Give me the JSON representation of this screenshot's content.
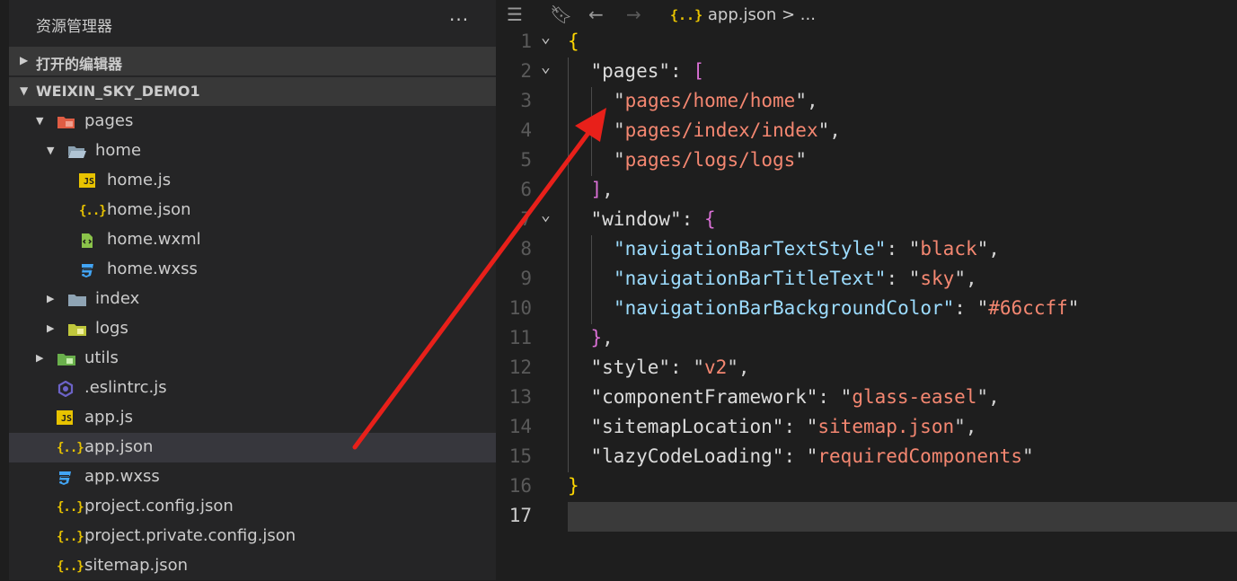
{
  "sidebar": {
    "title": "资源管理器",
    "more": "···",
    "open_editors": "打开的编辑器",
    "project": "WEIXIN_SKY_DEMO1",
    "tree": [
      {
        "name": "pages",
        "indent": 1,
        "twisty": "down",
        "icon": "folder-pages"
      },
      {
        "name": "home",
        "indent": 2,
        "twisty": "down",
        "icon": "folder-open"
      },
      {
        "name": "home.js",
        "indent": 3,
        "icon": "js"
      },
      {
        "name": "home.json",
        "indent": 3,
        "icon": "json"
      },
      {
        "name": "home.wxml",
        "indent": 3,
        "icon": "wxml"
      },
      {
        "name": "home.wxss",
        "indent": 3,
        "icon": "wxss"
      },
      {
        "name": "index",
        "indent": 2,
        "twisty": "right",
        "icon": "folder"
      },
      {
        "name": "logs",
        "indent": 2,
        "twisty": "right",
        "icon": "folder-logs"
      },
      {
        "name": "utils",
        "indent": 1,
        "twisty": "right",
        "icon": "folder-utils"
      },
      {
        "name": ".eslintrc.js",
        "indent": 1,
        "icon": "eslint"
      },
      {
        "name": "app.js",
        "indent": 1,
        "icon": "js"
      },
      {
        "name": "app.json",
        "indent": 1,
        "icon": "json",
        "selected": true
      },
      {
        "name": "app.wxss",
        "indent": 1,
        "icon": "wxss"
      },
      {
        "name": "project.config.json",
        "indent": 1,
        "icon": "json"
      },
      {
        "name": "project.private.config.json",
        "indent": 1,
        "icon": "json"
      },
      {
        "name": "sitemap.json",
        "indent": 1,
        "icon": "json"
      }
    ]
  },
  "editor": {
    "breadcrumb_icon": "{..}",
    "breadcrumb_file": "app.json",
    "breadcrumb_more": "> ...",
    "current_line": 17,
    "lines": [
      {
        "n": "1",
        "fold": true,
        "indent": 0,
        "tokens": [
          [
            "{",
            "brace"
          ]
        ]
      },
      {
        "n": "2",
        "fold": true,
        "indent": 1,
        "tokens": [
          [
            "\"pages\"",
            "key2"
          ],
          [
            ": ",
            "punc"
          ],
          [
            "[",
            "bracket"
          ]
        ]
      },
      {
        "n": "3",
        "indent": 2,
        "tokens": [
          [
            "\"",
            "punc"
          ],
          [
            "pages/home/home",
            "strr"
          ],
          [
            "\"",
            "punc"
          ],
          [
            ",",
            "punc"
          ]
        ]
      },
      {
        "n": "4",
        "indent": 2,
        "tokens": [
          [
            "\"",
            "punc"
          ],
          [
            "pages/index/index",
            "strr"
          ],
          [
            "\"",
            "punc"
          ],
          [
            ",",
            "punc"
          ]
        ]
      },
      {
        "n": "5",
        "indent": 2,
        "tokens": [
          [
            "\"",
            "punc"
          ],
          [
            "pages/logs/logs",
            "strr"
          ],
          [
            "\"",
            "punc"
          ]
        ]
      },
      {
        "n": "6",
        "indent": 1,
        "tokens": [
          [
            "]",
            "bracket"
          ],
          [
            ",",
            "punc"
          ]
        ]
      },
      {
        "n": "7",
        "fold": true,
        "indent": 1,
        "tokens": [
          [
            "\"window\"",
            "key2"
          ],
          [
            ": ",
            "punc"
          ],
          [
            "{",
            "bracket"
          ]
        ]
      },
      {
        "n": "8",
        "indent": 2,
        "tokens": [
          [
            "\"navigationBarTextStyle\"",
            "key"
          ],
          [
            ": ",
            "punc"
          ],
          [
            "\"",
            "punc"
          ],
          [
            "black",
            "strr"
          ],
          [
            "\"",
            "punc"
          ],
          [
            ",",
            "punc"
          ]
        ]
      },
      {
        "n": "9",
        "indent": 2,
        "tokens": [
          [
            "\"navigationBarTitleText\"",
            "key"
          ],
          [
            ": ",
            "punc"
          ],
          [
            "\"",
            "punc"
          ],
          [
            "sky",
            "strr"
          ],
          [
            "\"",
            "punc"
          ],
          [
            ",",
            "punc"
          ]
        ]
      },
      {
        "n": "10",
        "indent": 2,
        "tokens": [
          [
            "\"navigationBarBackgroundColor\"",
            "key"
          ],
          [
            ": ",
            "punc"
          ],
          [
            "\"",
            "punc"
          ],
          [
            "#66ccff",
            "strr"
          ],
          [
            "\"",
            "punc"
          ]
        ]
      },
      {
        "n": "11",
        "indent": 1,
        "tokens": [
          [
            "}",
            "bracket"
          ],
          [
            ",",
            "punc"
          ]
        ]
      },
      {
        "n": "12",
        "indent": 1,
        "tokens": [
          [
            "\"style\"",
            "key2"
          ],
          [
            ": ",
            "punc"
          ],
          [
            "\"",
            "punc"
          ],
          [
            "v2",
            "strr"
          ],
          [
            "\"",
            "punc"
          ],
          [
            ",",
            "punc"
          ]
        ]
      },
      {
        "n": "13",
        "indent": 1,
        "tokens": [
          [
            "\"componentFramework\"",
            "key2"
          ],
          [
            ": ",
            "punc"
          ],
          [
            "\"",
            "punc"
          ],
          [
            "glass-easel",
            "strr"
          ],
          [
            "\"",
            "punc"
          ],
          [
            ",",
            "punc"
          ]
        ]
      },
      {
        "n": "14",
        "indent": 1,
        "tokens": [
          [
            "\"sitemapLocation\"",
            "key2"
          ],
          [
            ": ",
            "punc"
          ],
          [
            "\"",
            "punc"
          ],
          [
            "sitemap.json",
            "strr"
          ],
          [
            "\"",
            "punc"
          ],
          [
            ",",
            "punc"
          ]
        ]
      },
      {
        "n": "15",
        "indent": 1,
        "tokens": [
          [
            "\"lazyCodeLoading\"",
            "key2"
          ],
          [
            ": ",
            "punc"
          ],
          [
            "\"",
            "punc"
          ],
          [
            "requiredComponents",
            "strr"
          ],
          [
            "\"",
            "punc"
          ]
        ]
      },
      {
        "n": "16",
        "indent": 0,
        "tokens": [
          [
            "}",
            "brace"
          ]
        ]
      },
      {
        "n": "17",
        "indent": 0,
        "tokens": []
      }
    ]
  },
  "colors": {
    "arrow": "#e8201a",
    "accent_yellow": "#e8c300"
  }
}
